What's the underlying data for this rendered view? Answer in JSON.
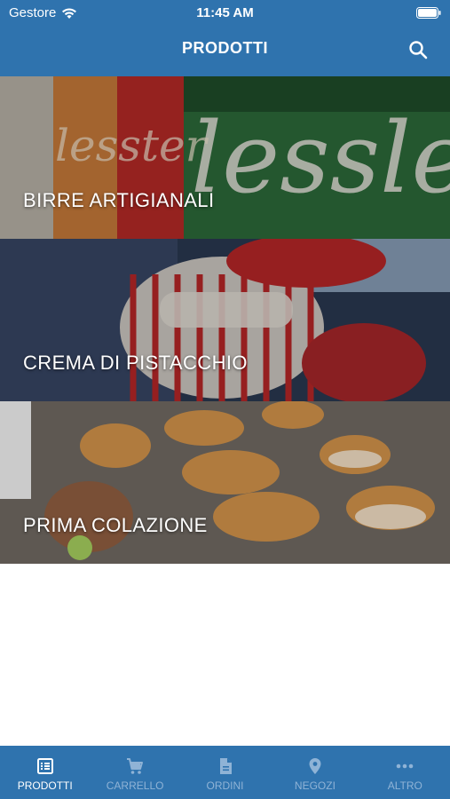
{
  "status_bar": {
    "carrier": "Gestore",
    "time": "11:45 AM"
  },
  "header": {
    "title": "PRODOTTI",
    "search_icon": "search-icon"
  },
  "categories": [
    {
      "label": "BIRRE ARTIGIANALI"
    },
    {
      "label": "CREMA DI PISTACCHIO"
    },
    {
      "label": "PRIMA COLAZIONE"
    }
  ],
  "tabs": [
    {
      "label": "PRODOTTI",
      "icon": "list-icon",
      "active": true
    },
    {
      "label": "CARRELLO",
      "icon": "cart-icon",
      "active": false
    },
    {
      "label": "ORDINI",
      "icon": "document-icon",
      "active": false
    },
    {
      "label": "NEGOZI",
      "icon": "location-icon",
      "active": false
    },
    {
      "label": "ALTRO",
      "icon": "more-icon",
      "active": false
    }
  ],
  "colors": {
    "primary": "#2f73ae",
    "tab_inactive": "#8fb3d6",
    "tab_active": "#ffffff"
  }
}
